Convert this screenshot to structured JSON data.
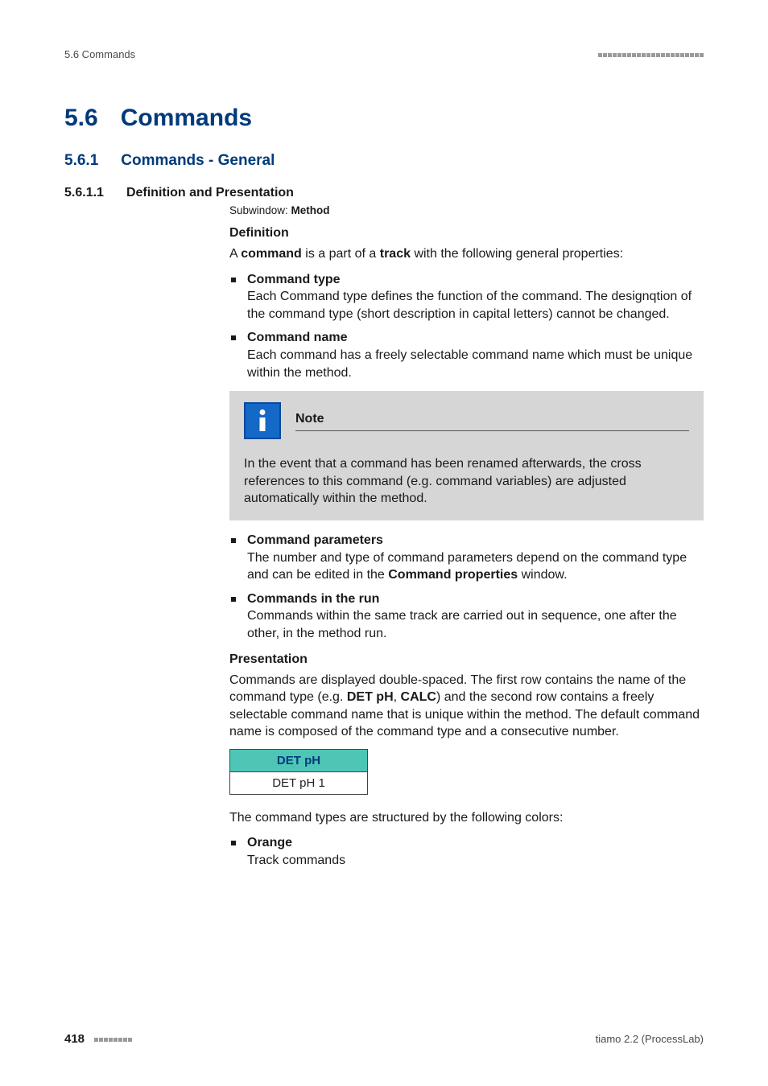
{
  "header": {
    "left": "5.6 Commands"
  },
  "chapter": {
    "num": "5.6",
    "title": "Commands"
  },
  "section": {
    "num": "5.6.1",
    "title": "Commands - General"
  },
  "subsection": {
    "num": "5.6.1.1",
    "title": "Definition and Presentation"
  },
  "subwindow": {
    "prefix": "Subwindow: ",
    "name": "Method"
  },
  "definition": {
    "heading": "Definition",
    "intro_pre": "A ",
    "intro_b1": "command",
    "intro_mid": " is a part of a ",
    "intro_b2": "track",
    "intro_post": " with the following general properties:",
    "items": {
      "cmd_type": {
        "title": "Command type",
        "body": "Each Command type defines the function of the command. The designqtion of the command type (short description in capital letters) cannot be changed."
      },
      "cmd_name": {
        "title": "Command name",
        "body": "Each command has a freely selectable command name which must be unique within the method."
      },
      "cmd_params": {
        "title": "Command parameters",
        "body_pre": "The number and type of command parameters depend on the command type and can be edited in the ",
        "body_b": "Command properties",
        "body_post": " window."
      },
      "cmd_run": {
        "title": "Commands in the run",
        "body": "Commands within the same track are carried out in sequence, one after the other, in the method run."
      }
    }
  },
  "note": {
    "label": "Note",
    "body": "In the event that a command has been renamed afterwards, the cross references to this command (e.g. command variables) are adjusted automatically within the method."
  },
  "presentation": {
    "heading": "Presentation",
    "para_pre": "Commands are displayed double-spaced. The first row contains the name of the command type (e.g. ",
    "para_b1": "DET pH",
    "para_sep": ", ",
    "para_b2": "CALC",
    "para_post": ") and the second row contains a freely selectable command name that is unique within the method. The default command name is composed of the command type and a consecutive number.",
    "cmd_block": {
      "type": "DET pH",
      "name": "DET pH 1"
    },
    "colors_intro": "The command types are structured by the following colors:",
    "color_items": {
      "orange": {
        "title": "Orange",
        "body": "Track commands"
      }
    }
  },
  "footer": {
    "page": "418",
    "product": "tiamo 2.2 (ProcessLab)"
  }
}
